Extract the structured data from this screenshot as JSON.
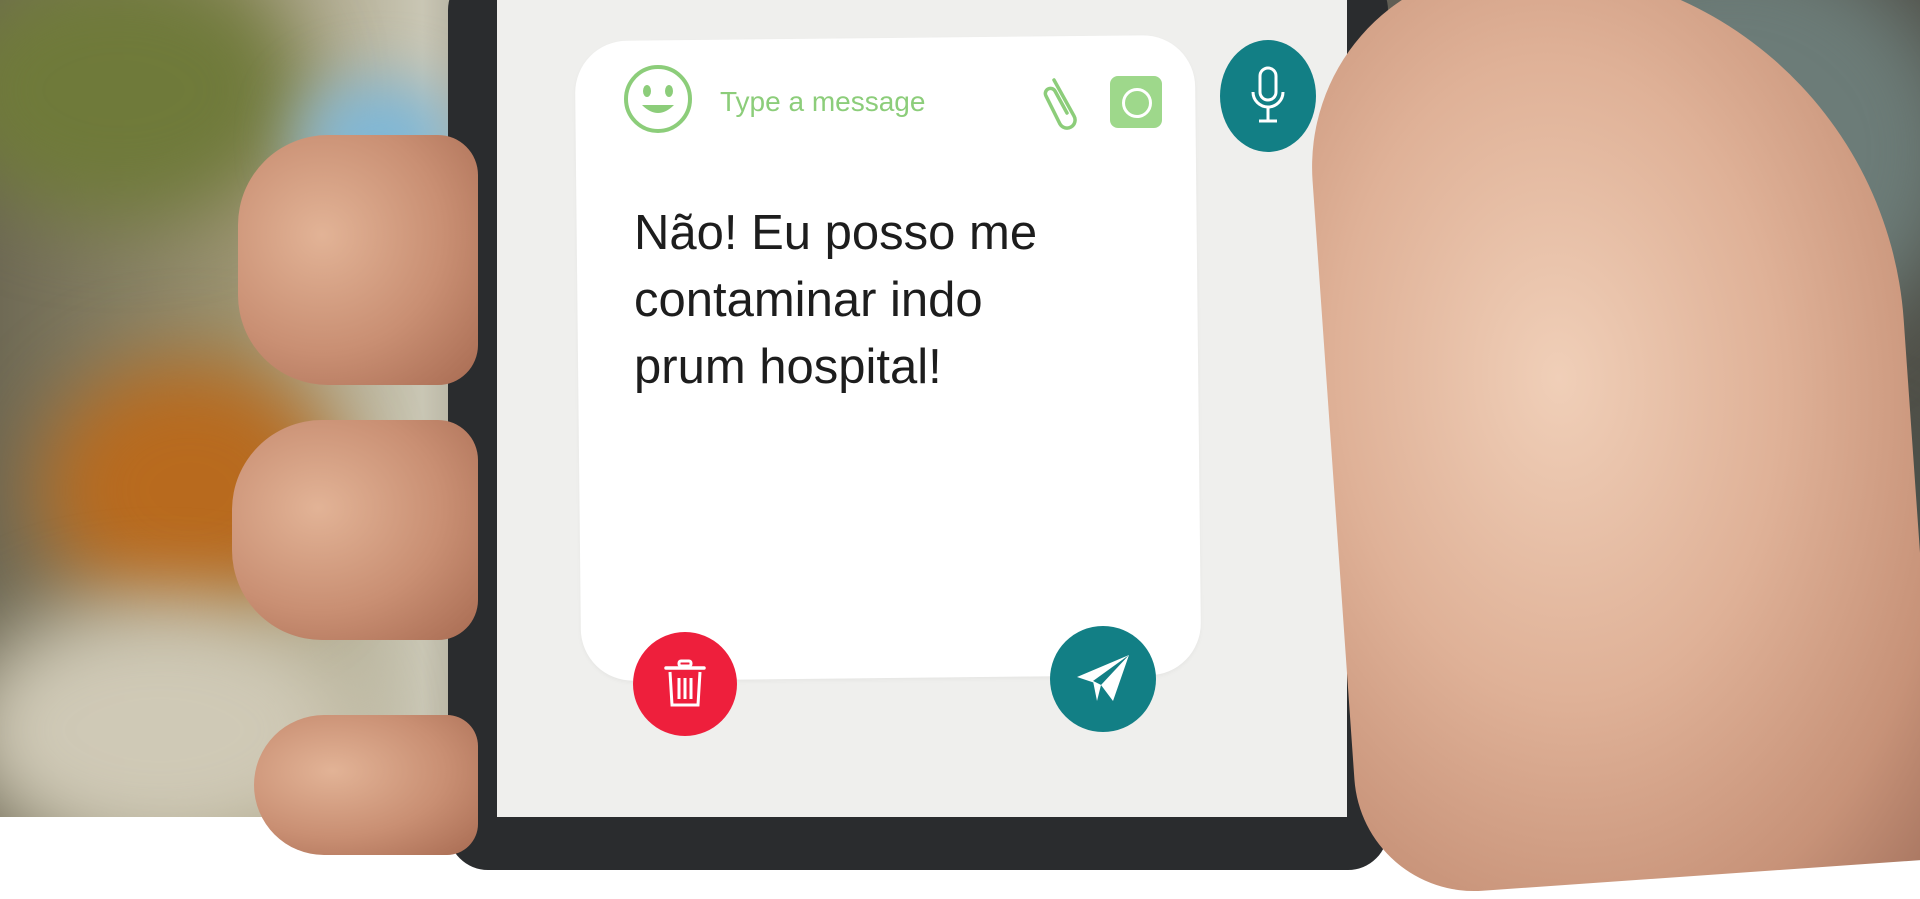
{
  "composer": {
    "placeholder": "Type a message",
    "message_text": "Não! Eu posso me\ncontaminar indo\nprum hospital!"
  },
  "icons": {
    "emoji": "emoji-icon",
    "attach": "paperclip-icon",
    "camera": "camera-icon",
    "mic": "microphone-icon",
    "delete": "trash-icon",
    "send": "send-icon"
  },
  "colors": {
    "accent_green": "#8ccd7a",
    "teal": "#127f85",
    "delete_red": "#ee1f3c",
    "card_white": "#ffffff",
    "screen_bg": "#efefed"
  }
}
